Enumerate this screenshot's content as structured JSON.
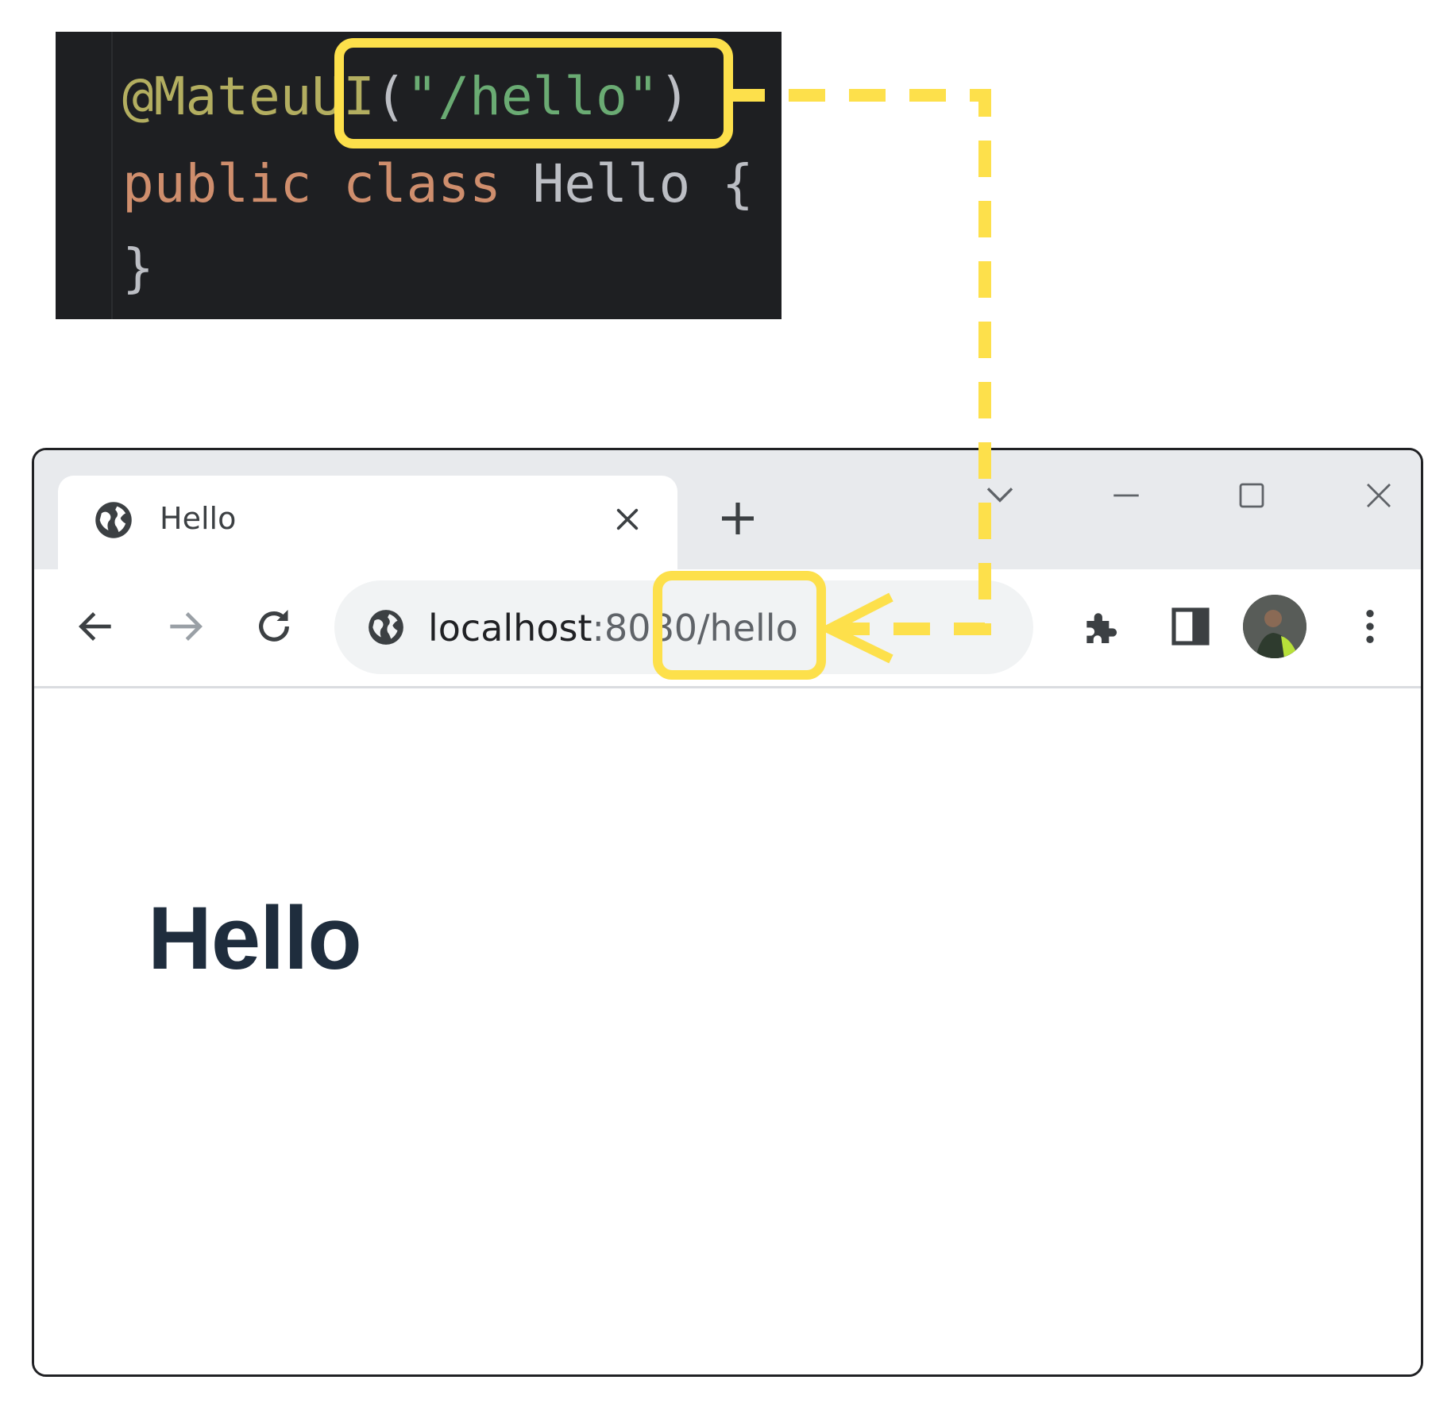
{
  "code": {
    "annotation": "@MateuUI",
    "paren_open": "(",
    "string": "\"/hello\"",
    "paren_close": ")",
    "keyword_public": "public",
    "keyword_class": "class",
    "class_name": "Hello",
    "brace_open": "{",
    "brace_close": "}"
  },
  "browser": {
    "tab": {
      "title": "Hello",
      "favicon": "globe-icon",
      "close_icon": "close-icon"
    },
    "new_tab_icon": "plus-icon",
    "tab_search_icon": "chevron-down-icon",
    "window_controls": [
      "minimize-icon",
      "maximize-icon",
      "close-icon"
    ],
    "nav": [
      "back-arrow-icon",
      "forward-arrow-icon",
      "reload-icon"
    ],
    "omnibox": {
      "icon": "globe-icon",
      "host": "localhost",
      "rest": ":8080/hello"
    },
    "toolbar_icons": [
      "puzzle-extensions-icon",
      "side-panel-icon",
      "avatar",
      "more-vertical-icon"
    ]
  },
  "page": {
    "heading": "Hello"
  },
  "colors": {
    "highlight": "#fde04b",
    "editor_bg": "#1e1f22",
    "heading": "#1f2d3d"
  }
}
